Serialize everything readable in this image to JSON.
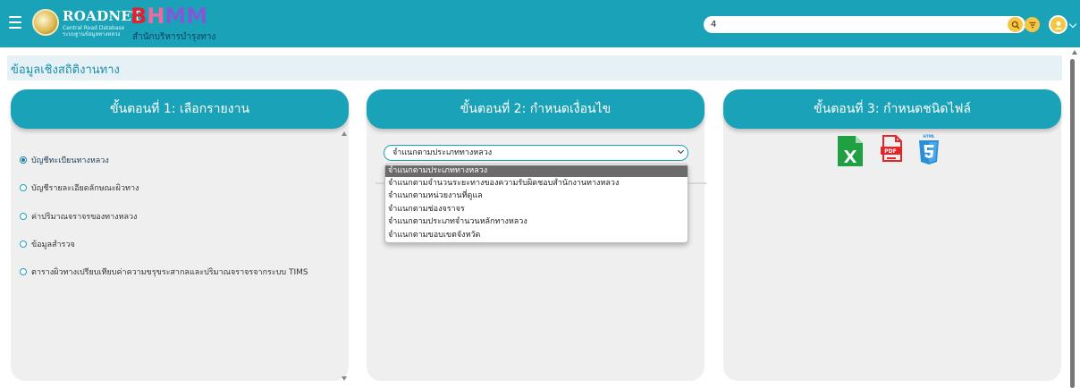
{
  "header": {
    "brand_main": "ROADNET",
    "brand_sub_line1": "Central Road Database",
    "brand_sub_line2": "ระบบฐานข้อมูลทางหลวง",
    "bhmm_letters": [
      "B",
      "H",
      "M",
      "M"
    ],
    "bhmm_subtitle": "สำนักบริหารบำรุงทาง",
    "search_value": "4"
  },
  "page": {
    "title": "ข้อมูลเชิงสถิติงานทาง"
  },
  "step1": {
    "title": "ขั้นตอนที่ 1: เลือกรายงาน",
    "items": [
      {
        "label": "บัญชีทะเบียนทางหลวง",
        "selected": true
      },
      {
        "label": "บัญชีรายละเอียดลักษณะผิวทาง",
        "selected": false
      },
      {
        "label": "ค่าปริมาณจราจรของทางหลวง",
        "selected": false
      },
      {
        "label": "ข้อมูลสำรวจ",
        "selected": false
      },
      {
        "label": "ตารางผิวทางเปรียบเทียบค่าความขรุขระสากลและปริมาณจราจรจากระบบ TIMS",
        "selected": false
      }
    ]
  },
  "step2": {
    "title": "ขั้นตอนที่ 2: กำหนดเงื่อนไข",
    "selected_value": "จำแนกตามประเภททางหลวง",
    "options": [
      "จำแนกตามประเภททางหลวง",
      "จำแนกตามจำนวนระยะทางของความรับผิดชอบสำนักงานทางหลวง",
      "จำแนกตามหน่วยงานที่ดูแล",
      "จำแนกตามช่องจราจร",
      "จำแนกตามประเภทจำนวนหลักทางหลวง",
      "จำแนกตามขอบเขตจังหวัด"
    ]
  },
  "step3": {
    "title": "ขั้นตอนที่ 3: กำหนดชนิดไฟล์",
    "icons": [
      "excel-icon",
      "pdf-icon",
      "html5-icon"
    ]
  },
  "colors": {
    "primary": "#1aa3b8",
    "accent_yellow": "#f6c744",
    "excel_green": "#21a043",
    "pdf_red": "#e5252a",
    "html_blue": "#2a8fd6"
  }
}
